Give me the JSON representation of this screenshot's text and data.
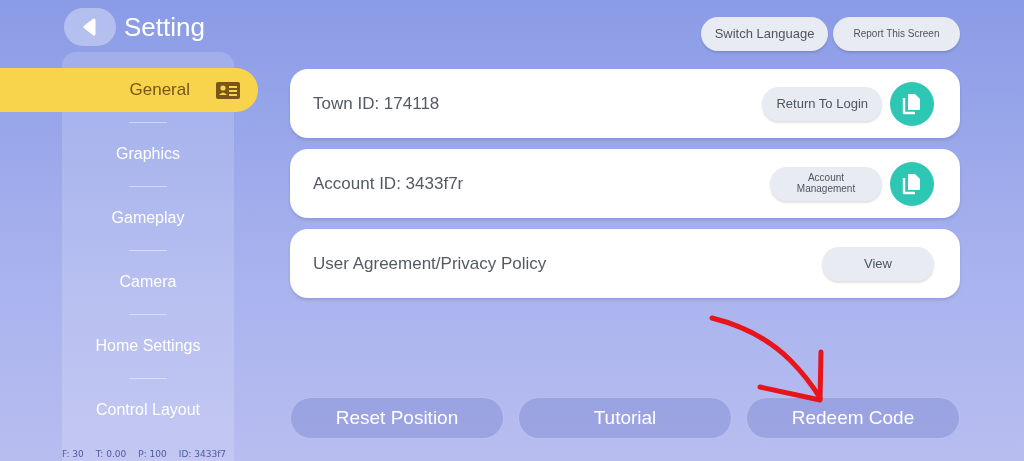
{
  "header": {
    "title": "Setting"
  },
  "sidebar": {
    "items": [
      {
        "label": "General",
        "selected": true
      },
      {
        "label": "Graphics",
        "selected": false
      },
      {
        "label": "Gameplay",
        "selected": false
      },
      {
        "label": "Camera",
        "selected": false
      },
      {
        "label": "Home Settings",
        "selected": false
      },
      {
        "label": "Control Layout",
        "selected": false
      }
    ],
    "footer": [
      "F: 30",
      "T: 0.00",
      "P: 100",
      "ID: 3433f7"
    ]
  },
  "top_buttons": [
    {
      "label": "Switch Language",
      "kind": "normal"
    },
    {
      "label": "Report This Screen",
      "kind": "compact"
    }
  ],
  "rows": [
    {
      "label": "Town ID: 174118",
      "button": {
        "label": "Return To Login",
        "kind": "normal"
      },
      "copy": true
    },
    {
      "label": "Account ID: 3433f7r",
      "button": {
        "label": "Account Management",
        "kind": "compact"
      },
      "copy": true
    },
    {
      "label": "User Agreement/Privacy Policy",
      "button": {
        "label": "View",
        "kind": "normal"
      },
      "copy": false
    }
  ],
  "bottom_buttons": [
    "Reset Position",
    "Tutorial",
    "Redeem Code"
  ]
}
